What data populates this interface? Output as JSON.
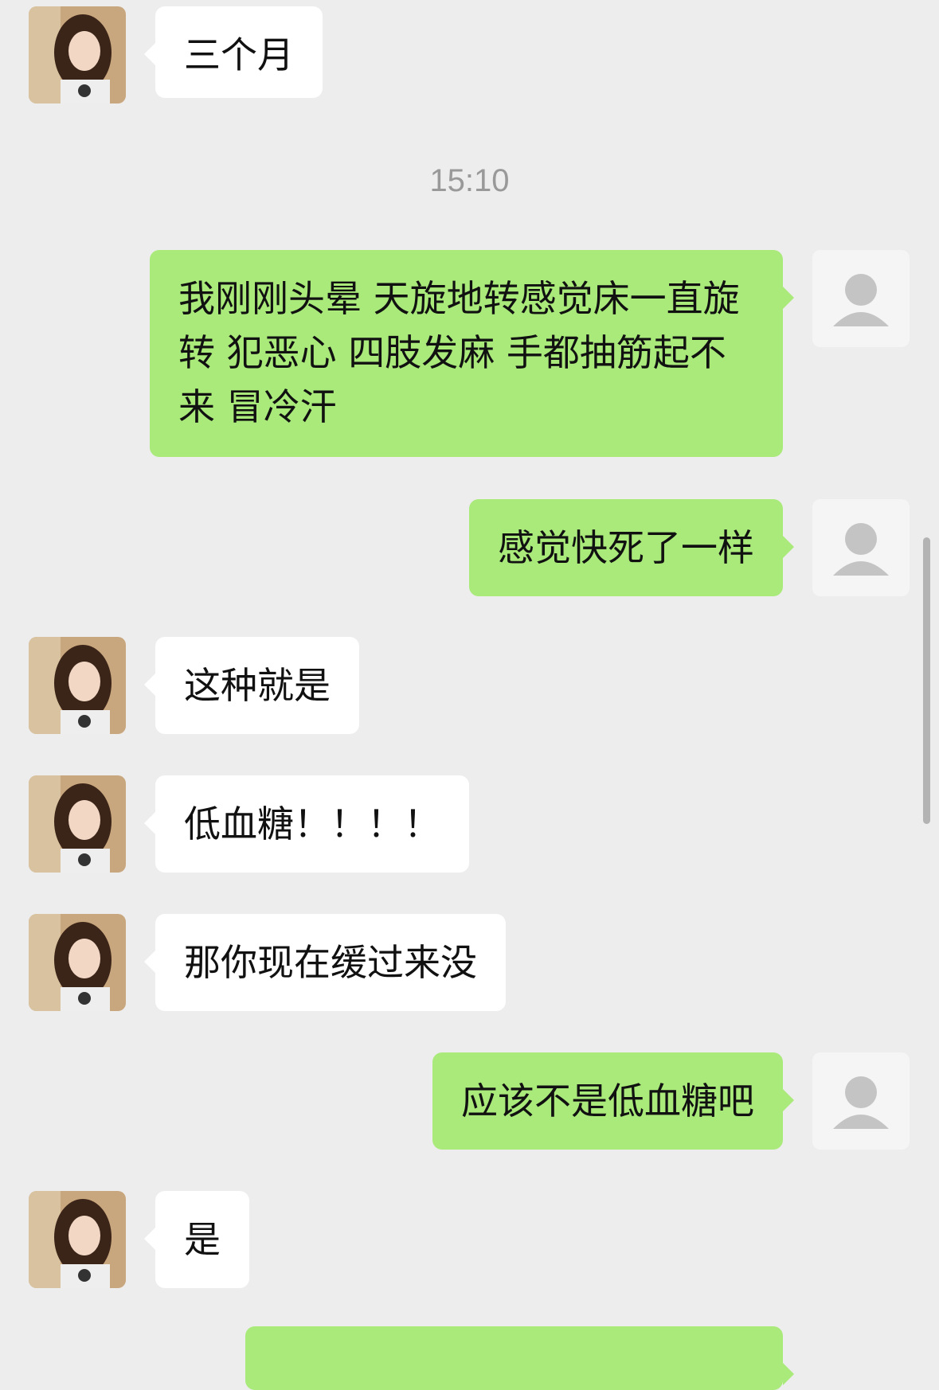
{
  "chat": {
    "timestamp": "15:10",
    "messages": [
      {
        "id": "m1",
        "side": "in",
        "text": "三个月"
      },
      {
        "id": "m2",
        "side": "out",
        "text": "我刚刚头晕 天旋地转感觉床一直旋转 犯恶心 四肢发麻 手都抽筋起不来 冒冷汗"
      },
      {
        "id": "m3",
        "side": "out",
        "text": "感觉快死了一样"
      },
      {
        "id": "m4",
        "side": "in",
        "text": "这种就是"
      },
      {
        "id": "m5",
        "side": "in",
        "text": "低血糖！！！！"
      },
      {
        "id": "m6",
        "side": "in",
        "text": "那你现在缓过来没"
      },
      {
        "id": "m7",
        "side": "out",
        "text": "应该不是低血糖吧"
      },
      {
        "id": "m8",
        "side": "in",
        "text": "是"
      },
      {
        "id": "m9",
        "side": "out",
        "text": ""
      }
    ]
  },
  "colors": {
    "background": "#ededed",
    "incoming_bubble": "#ffffff",
    "outgoing_bubble": "#a9ea7a",
    "timestamp_text": "#999999"
  },
  "icons": {
    "contact_avatar": "photo-avatar",
    "self_avatar": "default-user-icon"
  }
}
